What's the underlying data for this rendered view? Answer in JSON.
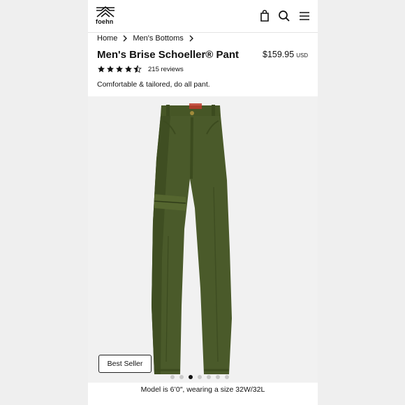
{
  "brand": {
    "logo_text": "foehn"
  },
  "header": {
    "icons": [
      "bag-icon",
      "search-icon",
      "menu-icon"
    ]
  },
  "breadcrumb": {
    "items": [
      "Home",
      "Men's Bottoms"
    ]
  },
  "product": {
    "title": "Men's Brise Schoeller® Pant",
    "price": "$159.95",
    "currency": "USD",
    "rating": 4.5,
    "reviews": "215 reviews",
    "tagline": "Comfortable & tailored, do all pant."
  },
  "gallery": {
    "badge": "Best Seller",
    "dots_total": 7,
    "active_dot": 3,
    "caption": "Model is 6’0″, wearing a size 32W/32L"
  },
  "colors": {
    "pants_olive": "#4a5a2a",
    "background": "#efefef",
    "accent_black": "#111111"
  }
}
